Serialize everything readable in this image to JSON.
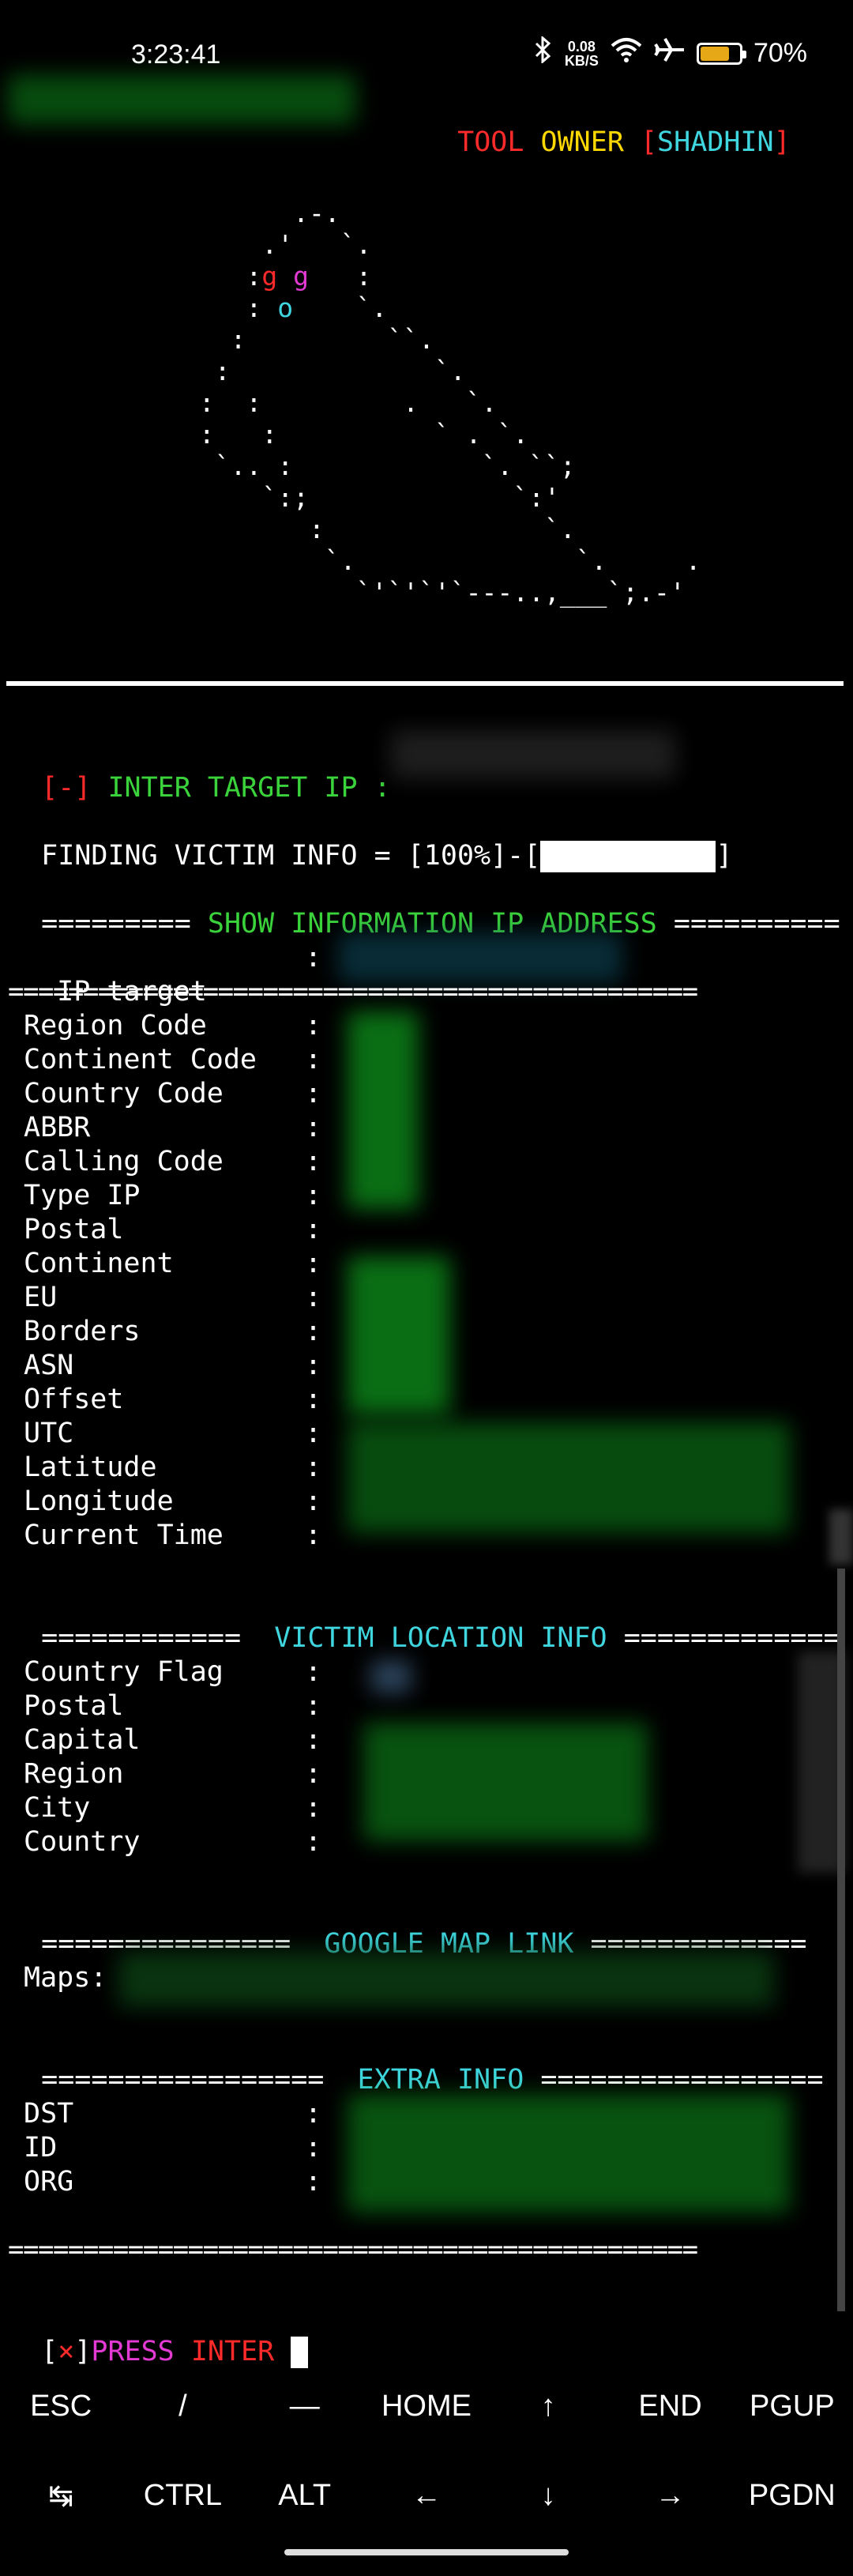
{
  "status_bar": {
    "time": "3:23:41",
    "net_speed_value": "0.08",
    "net_speed_unit": "KB/S",
    "battery": "70%"
  },
  "banner": {
    "tool": "TOOL",
    "owner": "OWNER",
    "open_bracket": "[",
    "name": "SHADHIN",
    "close_bracket": "]"
  },
  "ascii_art": [
    "       .-.",
    "     .'   `.",
    "    :g g   :",
    "    : o    `.",
    "   :         ``.",
    "  :             `.",
    " :  :         .   `.",
    " :   :          ` . `.",
    "  `.. :            `. ``;",
    "     `:;             `:'",
    "        :              `.",
    "         `.              `.     .",
    "           `'`'`'`---..,___`;.-'"
  ],
  "prompt": {
    "marker": "[-]",
    "label": "INTER TARGET IP :",
    "finding": "FINDING VICTIM INFO = [100%]-[",
    "finding_end": "]"
  },
  "sections": {
    "show_info": "========= SHOW INFORMATION IP ADDRESS ==========",
    "show_info_left": "=========",
    "show_info_title": "SHOW INFORMATION IP ADDRESS",
    "show_info_right": "==========",
    "divider": "==============================================",
    "victim_left": "============",
    "victim_title": "VICTIM LOCATION INFO",
    "victim_right": "=============",
    "maps_left": "===============",
    "maps_title": "GOOGLE MAP LINK",
    "maps_right": "=============",
    "extra_left": "=================",
    "extra_title": "EXTRA INFO",
    "extra_right": "================="
  },
  "ip_target_label": "IP target",
  "ip_fields": [
    "Region Code",
    "Continent Code",
    "Country Code",
    "ABBR",
    "Calling Code",
    "Type IP",
    "Postal",
    "Continent",
    "EU",
    "Borders",
    "ASN",
    "Offset",
    "UTC",
    "Latitude",
    "Longitude",
    "Current Time"
  ],
  "location_fields": [
    "Country Flag",
    "Postal",
    "Capital",
    "Region",
    "City",
    "Country"
  ],
  "maps_label": "Maps:",
  "extra_fields": [
    "DST",
    "ID",
    "ORG"
  ],
  "separator": ":",
  "press": {
    "open": "[",
    "x": "×",
    "close": "]",
    "press": "PRESS",
    "inter": "INTER"
  },
  "keyboard": {
    "row1": [
      "ESC",
      "/",
      "—",
      "HOME",
      "↑",
      "END",
      "PGUP"
    ],
    "row2": [
      "↹",
      "CTRL",
      "ALT",
      "←",
      "↓",
      "→",
      "PGDN"
    ]
  },
  "colors": {
    "accent_green": "#3bd33b",
    "accent_red": "#ff2a2a",
    "accent_cyan": "#3fd6e0",
    "accent_yellow": "#ffd800",
    "accent_magenta": "#e23ad2"
  }
}
